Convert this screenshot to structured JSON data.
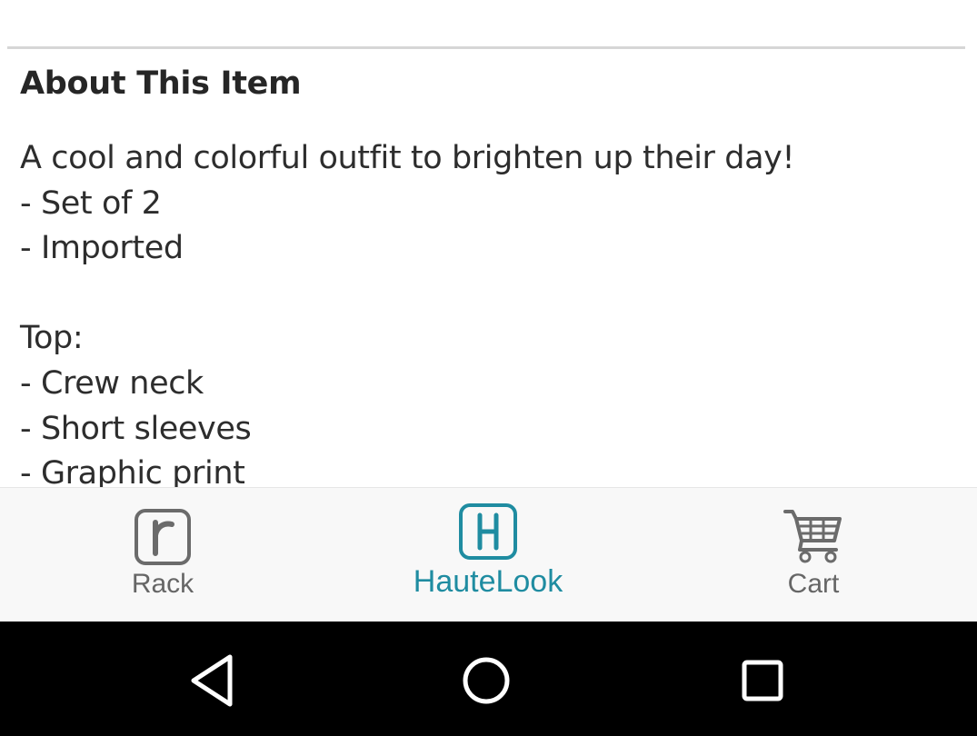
{
  "about": {
    "title": "About This Item",
    "lines": [
      "A cool and colorful outfit to brighten up their day!",
      "- Set of 2",
      "- Imported",
      "",
      "Top:",
      "- Crew neck",
      "- Short sleeves",
      "- Graphic print"
    ]
  },
  "tabbar": {
    "items": [
      {
        "label": "Rack",
        "icon": "rack-r-icon",
        "active": false
      },
      {
        "label": "HauteLook",
        "icon": "hautelook-h-icon",
        "active": true
      },
      {
        "label": "Cart",
        "icon": "cart-icon",
        "active": false
      }
    ],
    "active_color": "#1f8ca1",
    "inactive_color": "#666666"
  },
  "navbar": {
    "buttons": [
      "back-icon",
      "home-icon",
      "recents-icon"
    ]
  }
}
